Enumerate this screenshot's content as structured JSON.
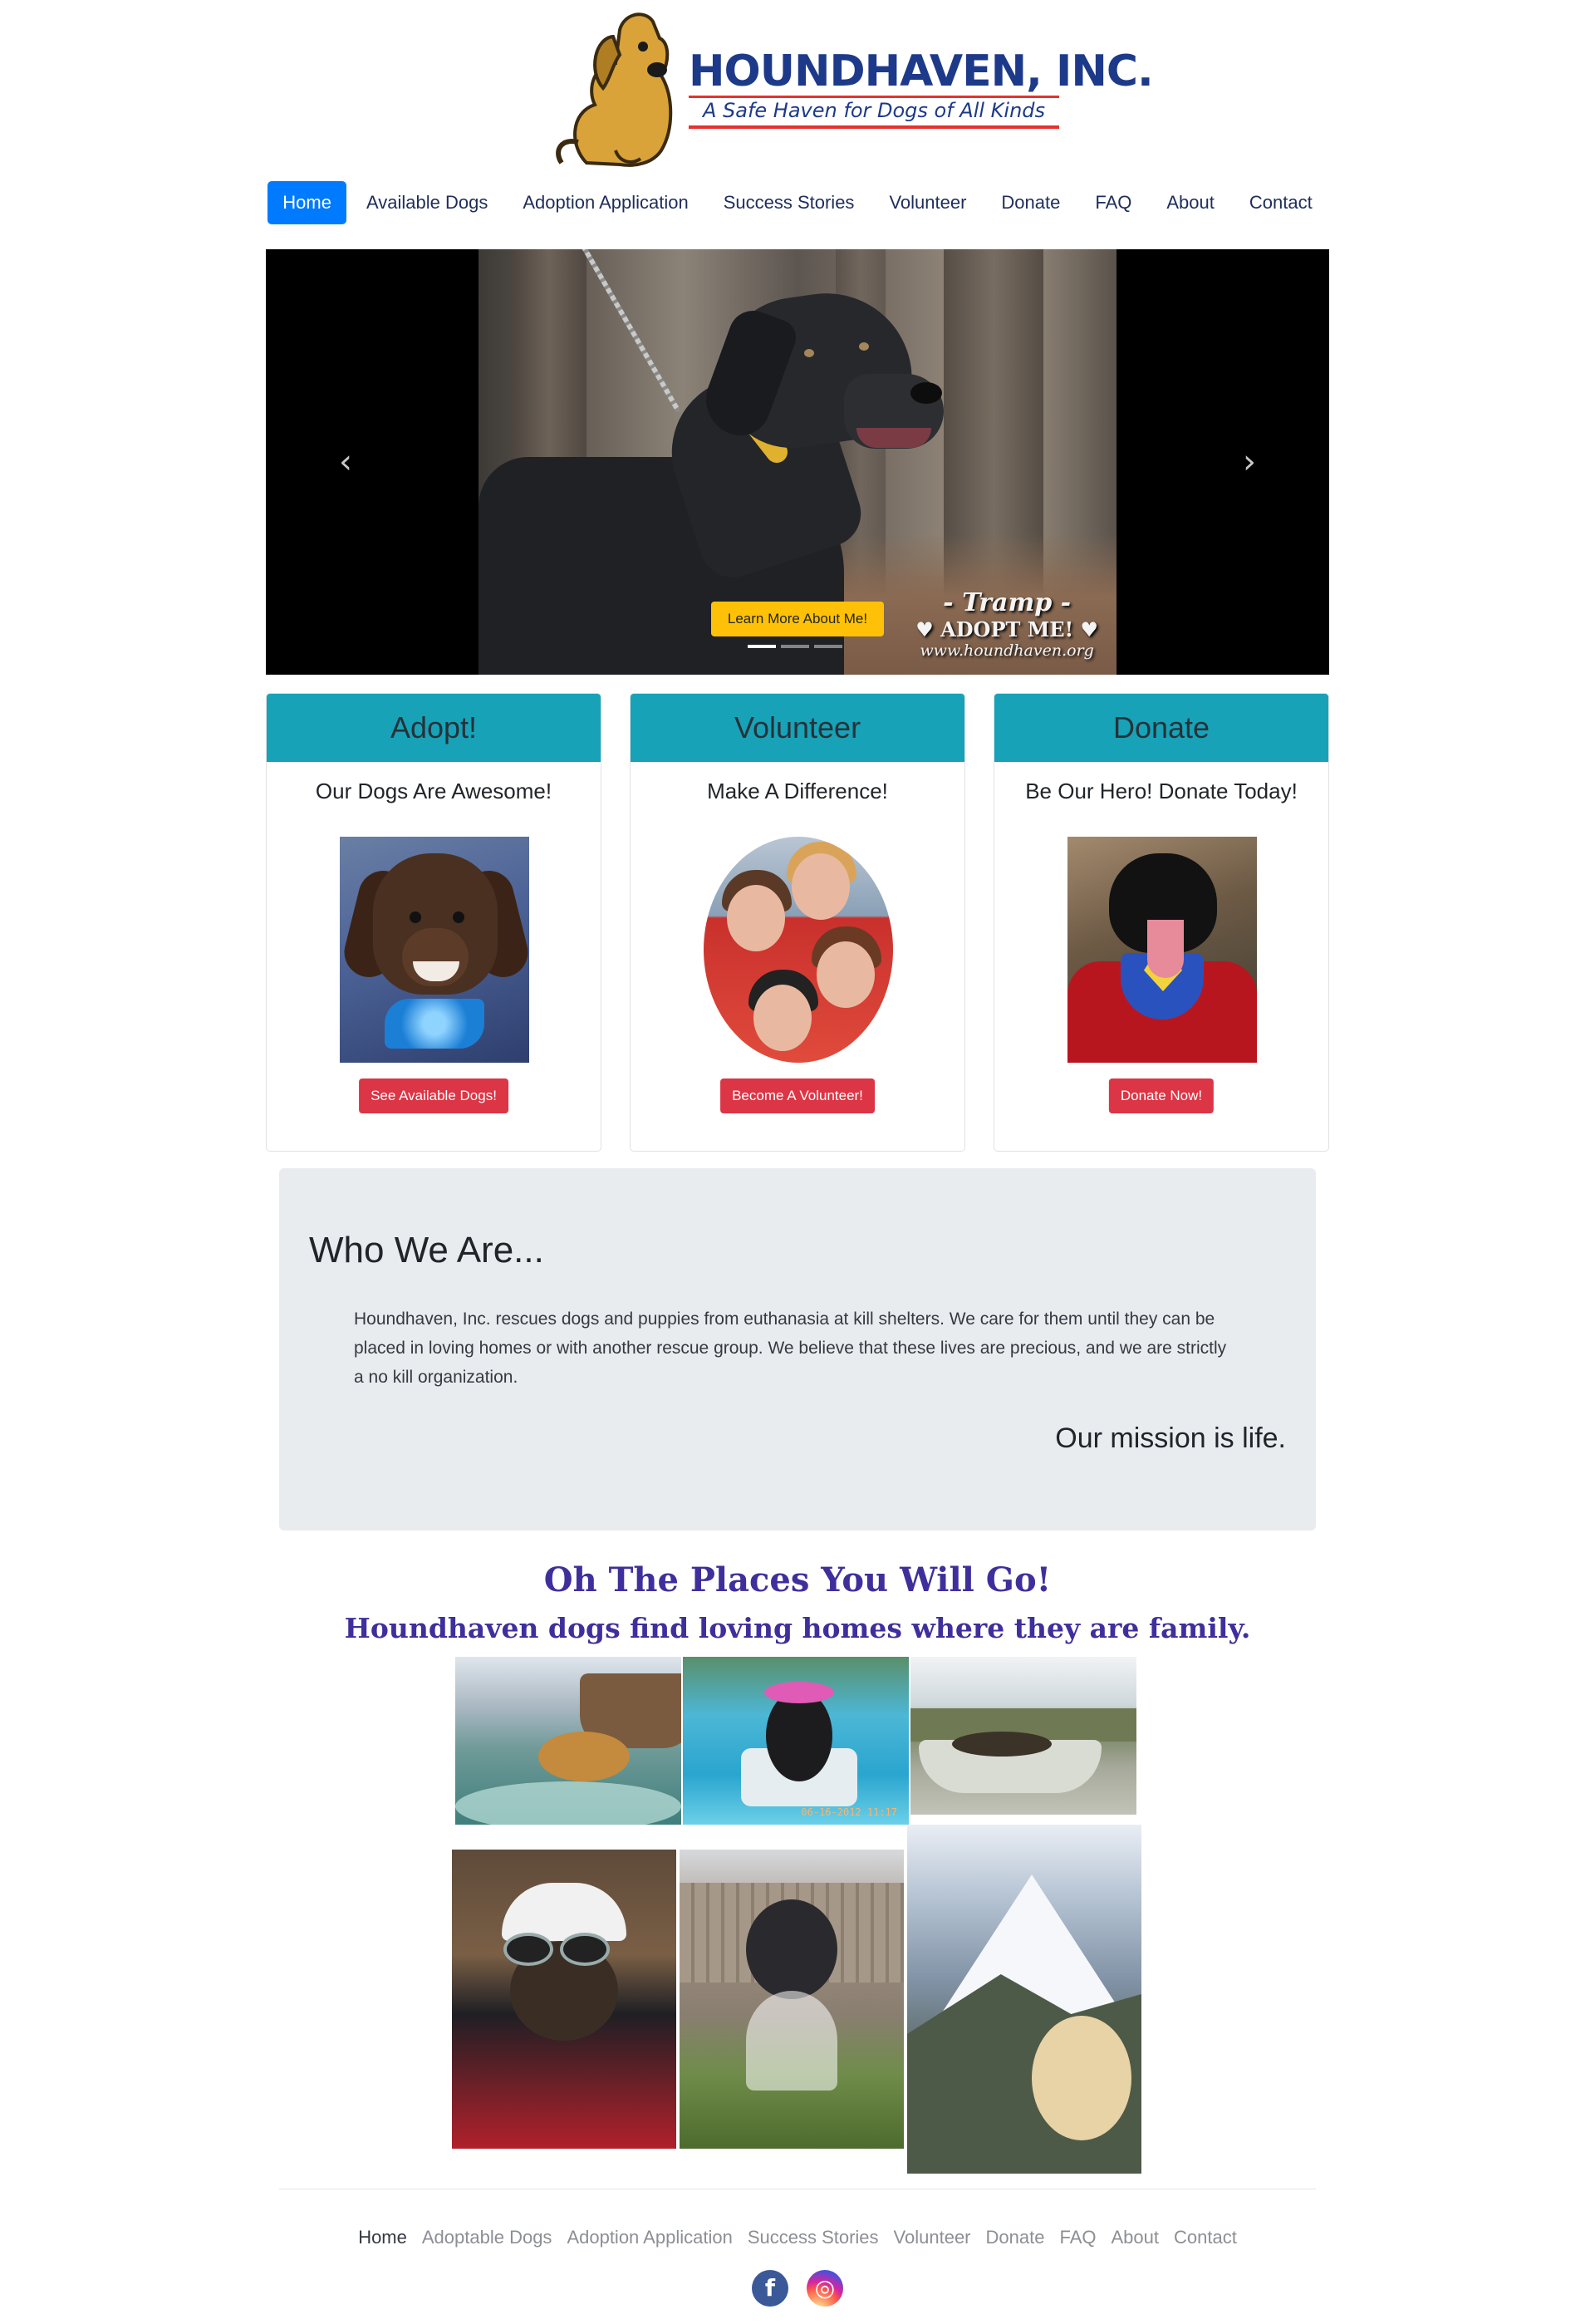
{
  "brand": {
    "name": "HOUNDHAVEN, INC.",
    "tagline": "A Safe Haven for Dogs of All Kinds",
    "colors": {
      "primary": "#1d3a8a",
      "accent": "#e5322d"
    }
  },
  "nav": {
    "items": [
      "Home",
      "Available Dogs",
      "Adoption Application",
      "Success Stories",
      "Volunteer",
      "Donate",
      "FAQ",
      "About",
      "Contact"
    ],
    "active": "Home"
  },
  "carousel": {
    "overlay_name": "- Tramp -",
    "overlay_adopt": "♥ ADOPT ME! ♥",
    "overlay_url": "www.houndhaven.org",
    "button_label": "Learn More About Me!",
    "slides": 3,
    "active_slide": 1,
    "prev_icon": "chevron-left-icon",
    "next_icon": "chevron-right-icon"
  },
  "cards": [
    {
      "header": "Adopt!",
      "subtitle": "Our Dogs Are Awesome!",
      "button": "See Available Dogs!"
    },
    {
      "header": "Volunteer",
      "subtitle": "Make A Difference!",
      "button": "Become A Volunteer!"
    },
    {
      "header": "Donate",
      "subtitle": "Be Our Hero! Donate Today!",
      "button": "Donate Now!"
    }
  ],
  "about": {
    "heading": "Who We Are...",
    "text": "Houndhaven, Inc. rescues dogs and puppies from euthanasia at kill shelters. We care for them until they can be placed in loving homes or with another rescue group. We believe that these lives are precious, and we are strictly a no kill organization.",
    "mission": "Our mission is life."
  },
  "places": {
    "title": "Oh The Places You Will Go!",
    "subtitle": "Houndhaven dogs find loving homes where they are family.",
    "photo_stamp": "06-16-2012 11:17"
  },
  "footer": {
    "items": [
      "Home",
      "Adoptable Dogs",
      "Adoption Application",
      "Success Stories",
      "Volunteer",
      "Donate",
      "FAQ",
      "About",
      "Contact"
    ],
    "active": "Home",
    "social": [
      {
        "name": "facebook-icon",
        "glyph": "f"
      },
      {
        "name": "instagram-icon",
        "glyph": "◎"
      }
    ]
  }
}
